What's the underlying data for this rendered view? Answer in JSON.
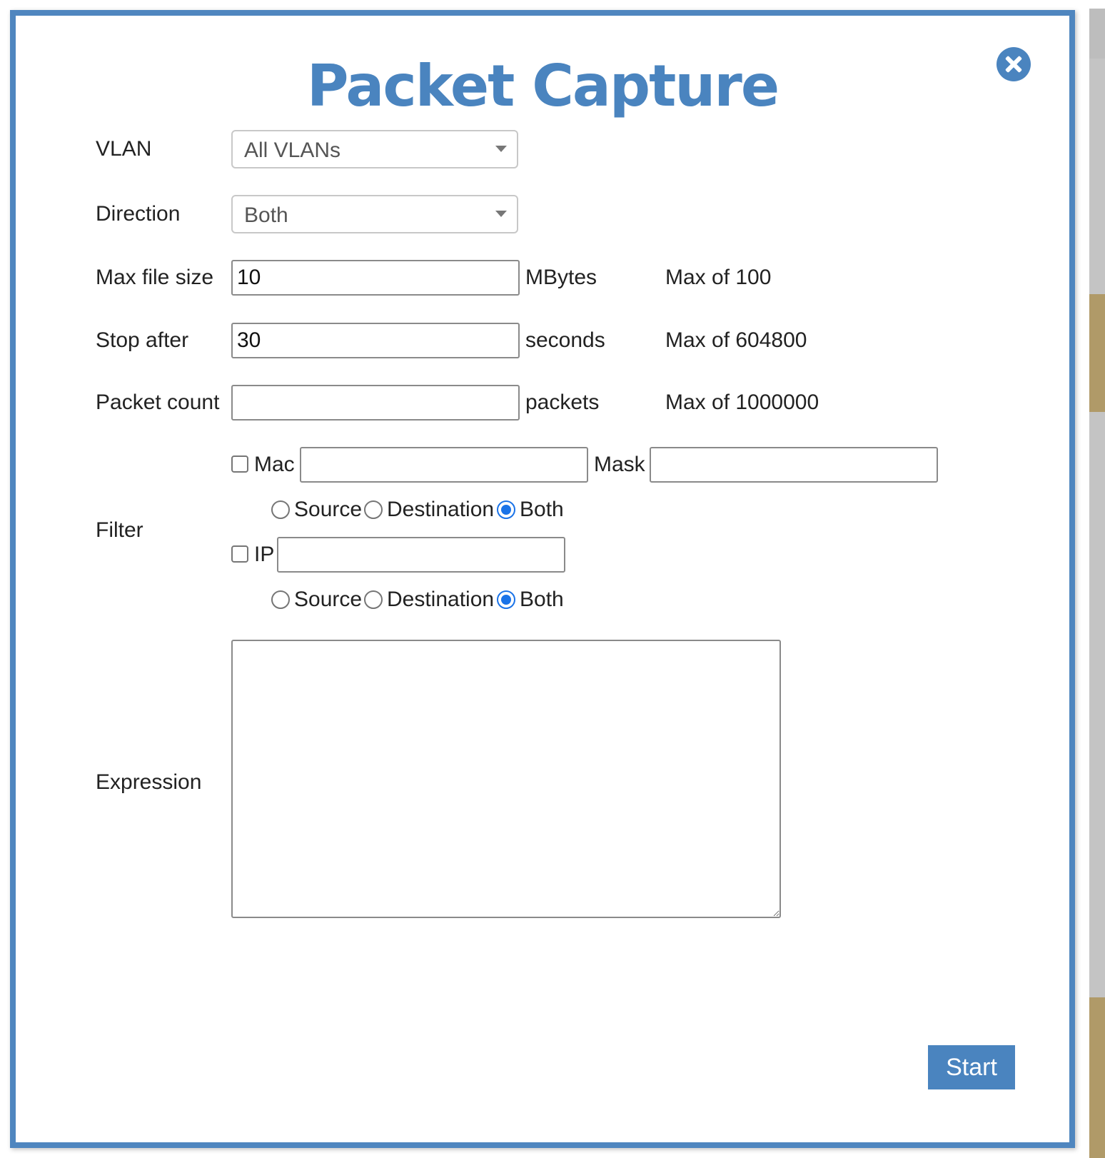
{
  "dialog": {
    "title": "Packet Capture"
  },
  "vlan": {
    "label": "VLAN",
    "selected": "All VLANs"
  },
  "direction": {
    "label": "Direction",
    "selected": "Both"
  },
  "max_file_size": {
    "label": "Max file size",
    "value": "10",
    "unit": "MBytes",
    "limit": "Max of 100"
  },
  "stop_after": {
    "label": "Stop after",
    "value": "30",
    "unit": "seconds",
    "limit": "Max of 604800"
  },
  "packet_count": {
    "label": "Packet count",
    "value": "",
    "unit": "packets",
    "limit": "Max of 1000000"
  },
  "filter": {
    "label": "Filter",
    "mac": {
      "label": "Mac",
      "value": "",
      "mask_label": "Mask",
      "mask_value": "",
      "radios": [
        "Source",
        "Destination",
        "Both"
      ],
      "selected": "Both"
    },
    "ip": {
      "label": "IP",
      "value": "",
      "radios": [
        "Source",
        "Destination",
        "Both"
      ],
      "selected": "Both"
    }
  },
  "expression": {
    "label": "Expression",
    "value": ""
  },
  "actions": {
    "start_label": "Start"
  },
  "colors": {
    "accent": "#4a84bf",
    "radio_selected": "#1a73e8",
    "backdrop_tan": "#b09a68",
    "backdrop_gray": "#bdbdbd"
  },
  "icons": {
    "close": "close-circle-icon"
  }
}
